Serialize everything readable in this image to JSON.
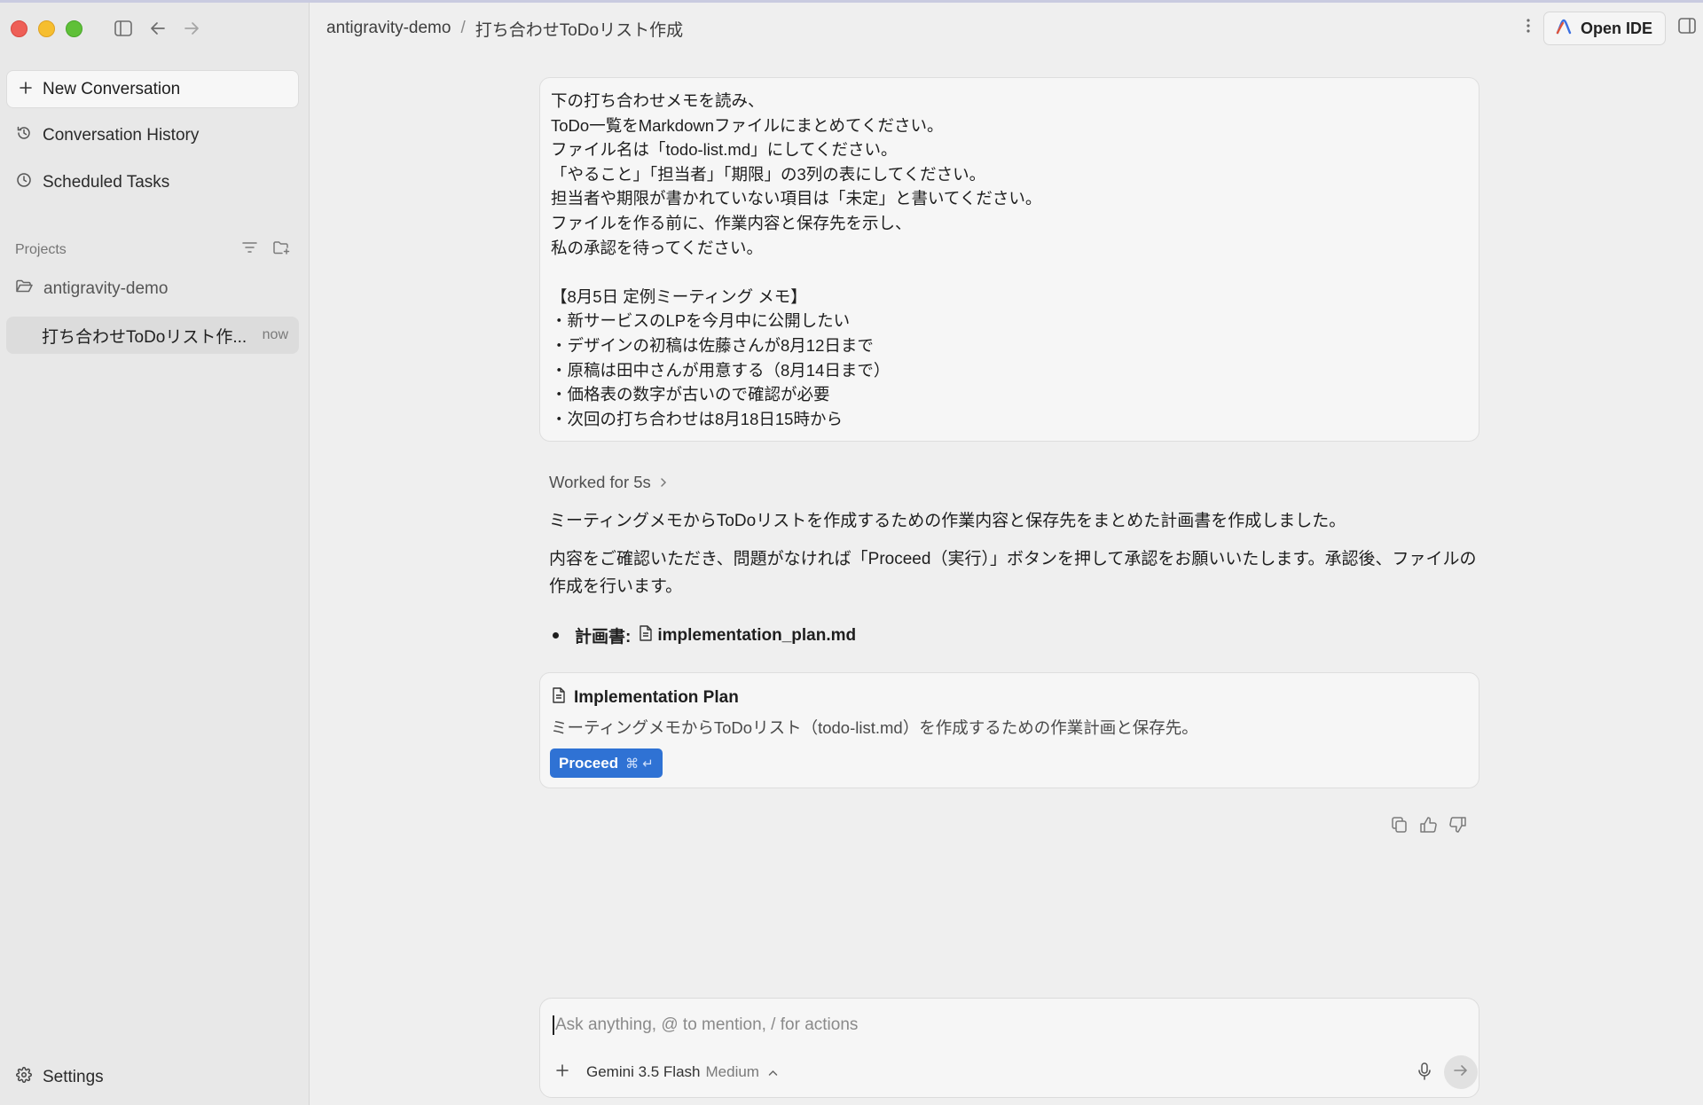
{
  "sidebar": {
    "new_conversation": "New Conversation",
    "conversation_history": "Conversation History",
    "scheduled_tasks": "Scheduled Tasks",
    "projects_label": "Projects",
    "project_name": "antigravity-demo",
    "conversation": {
      "title": "打ち合わせToDoリスト作...",
      "time": "now"
    },
    "settings": "Settings"
  },
  "breadcrumb": {
    "project": "antigravity-demo",
    "separator": "/",
    "conversation": "打ち合わせToDoリスト作成"
  },
  "toolbar": {
    "open_ide": "Open IDE"
  },
  "user_message": {
    "lines": [
      "下の打ち合わせメモを読み、",
      "ToDo一覧をMarkdownファイルにまとめてください。",
      "ファイル名は「todo-list.md」にしてください。",
      "「やること」「担当者」「期限」の3列の表にしてください。",
      "担当者や期限が書かれていない項目は「未定」と書いてください。",
      "ファイルを作る前に、作業内容と保存先を示し、",
      "私の承認を待ってください。",
      "",
      "【8月5日 定例ミーティング メモ】",
      "・新サービスのLPを今月中に公開したい",
      "・デザインの初稿は佐藤さんが8月12日まで",
      "・原稿は田中さんが用意する（8月14日まで）",
      "・価格表の数字が古いので確認が必要",
      "・次回の打ち合わせは8月18日15時から"
    ]
  },
  "assistant": {
    "worked": "Worked for 5s",
    "paragraph1": "ミーティングメモからToDoリストを作成するための作業内容と保存先をまとめた計画書を作成しました。",
    "paragraph2": "内容をご確認いただき、問題がなければ「Proceed（実行）」ボタンを押して承認をお願いいたします。承認後、ファイルの作成を行います。",
    "bullet_label": "計画書:",
    "bullet_file": "implementation_plan.md"
  },
  "plan_card": {
    "title": "Implementation Plan",
    "description": "ミーティングメモからToDoリスト（todo-list.md）を作成するための作業計画と保存先。",
    "proceed_label": "Proceed",
    "proceed_shortcut": "⌘ ↵"
  },
  "composer": {
    "placeholder": "Ask anything, @ to mention, / for actions",
    "model": "Gemini 3.5 Flash",
    "effort": "Medium"
  },
  "colors": {
    "accent": "#2f72d4",
    "close": "#ee5f57",
    "minimize": "#f6be2f",
    "zoom": "#5fc038"
  }
}
